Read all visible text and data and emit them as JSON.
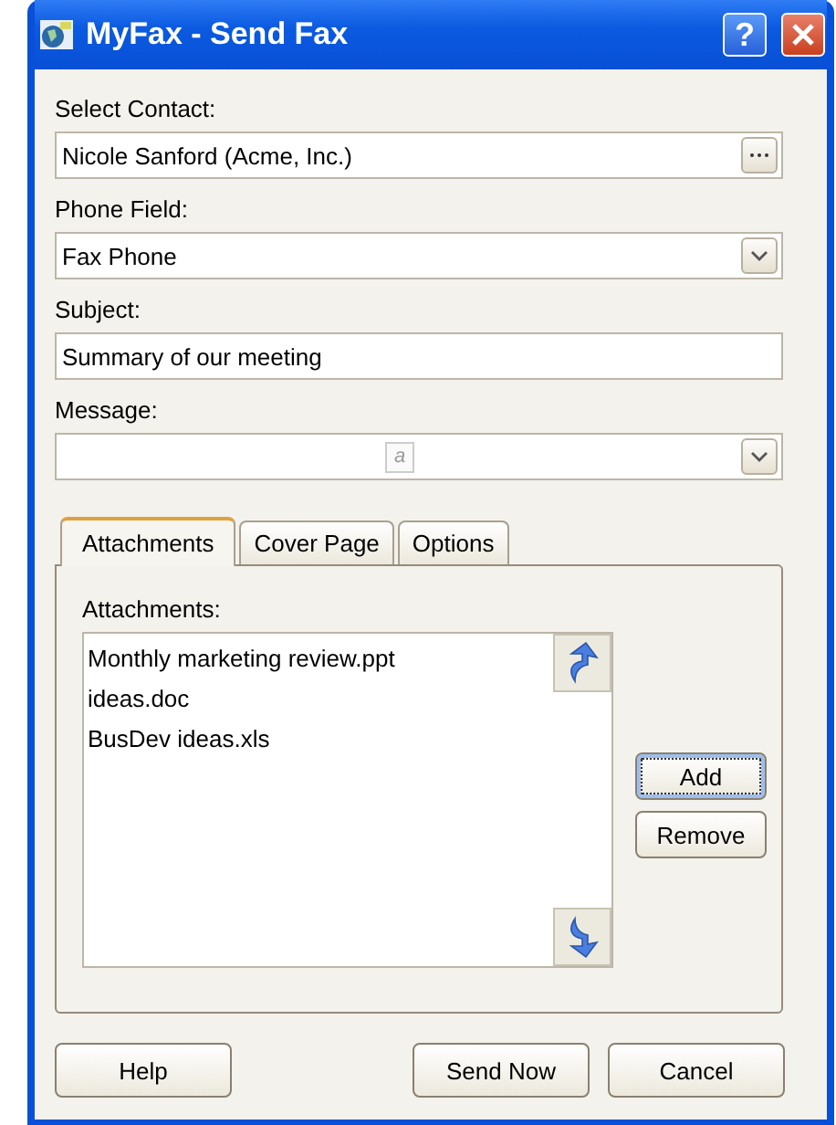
{
  "window": {
    "title": "MyFax - Send Fax",
    "help_glyph": "?"
  },
  "fields": [
    {
      "label": "Select Contact:",
      "kind": "picker",
      "value": "Nicole Sanford (Acme, Inc.)"
    },
    {
      "label": "Phone Field:",
      "kind": "dropdown",
      "value": "Fax Phone"
    },
    {
      "label": "Subject:",
      "kind": "text",
      "value": "Summary of our meeting"
    },
    {
      "label": "Message:",
      "kind": "dropdown",
      "value_icon": "a"
    }
  ],
  "tabs": [
    {
      "label": "Attachments",
      "selected": true
    },
    {
      "label": "Cover Page",
      "selected": false
    },
    {
      "label": "Options",
      "selected": false
    }
  ],
  "attachments": {
    "label": "Attachments:",
    "items": [
      "Monthly marketing review.ppt",
      "ideas.doc",
      "BusDev ideas.xls"
    ],
    "buttons": [
      {
        "label": "Add",
        "focused": true
      },
      {
        "label": "Remove",
        "focused": false
      }
    ]
  },
  "footer_buttons": [
    {
      "label": "Help",
      "kind": "left"
    },
    {
      "label": "Send Now",
      "kind": "right"
    },
    {
      "label": "Cancel",
      "kind": "right"
    }
  ]
}
